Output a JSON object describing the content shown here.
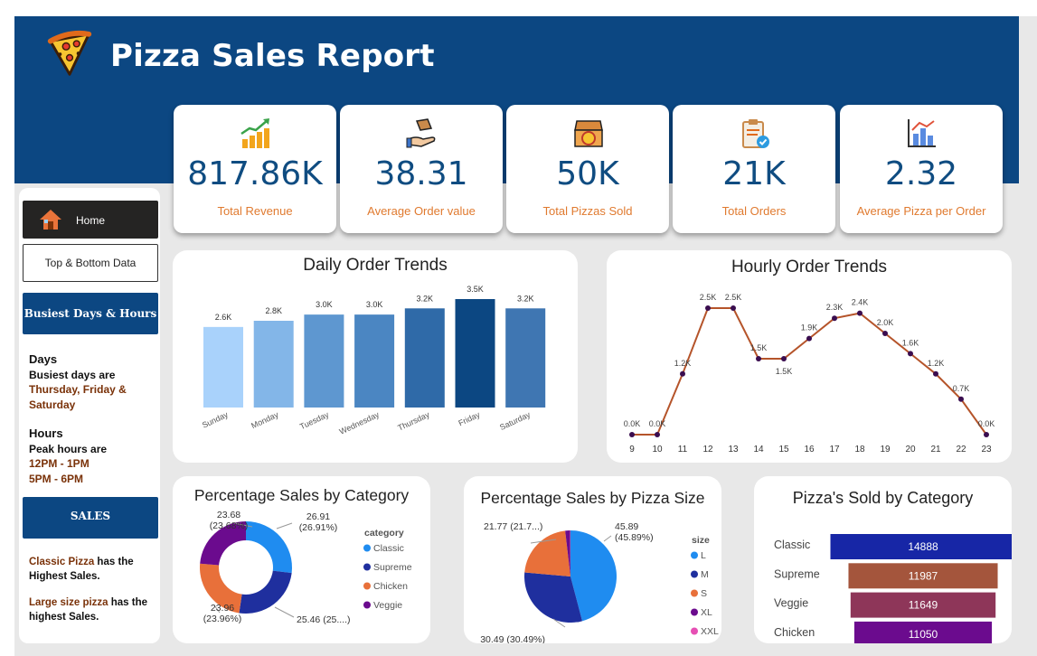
{
  "header": {
    "title": "Pizza Sales Report",
    "colors": {
      "banner": "#0c4782",
      "kpi_value": "#0f4c81",
      "kpi_label": "#e07a2f"
    }
  },
  "kpis": [
    {
      "icon": "rising-coins-chart-icon",
      "value": "817.86K",
      "label": "Total Revenue"
    },
    {
      "icon": "hand-with-box-icon",
      "value": "38.31",
      "label": "Average Order value"
    },
    {
      "icon": "pizza-box-icon",
      "value": "50K",
      "label": "Total Pizzas Sold"
    },
    {
      "icon": "clipboard-check-icon",
      "value": "21K",
      "label": "Total Orders"
    },
    {
      "icon": "bar-chart-icon",
      "value": "2.32",
      "label": "Average Pizza per Order"
    }
  ],
  "sidebar": {
    "home_label": "Home",
    "top_bottom_label": "Top & Bottom Data",
    "busiest_label": "Busiest Days & Hours",
    "days_heading": "Days",
    "days_text": "Busiest days are",
    "days_value_1": "Thursday, Friday &",
    "days_value_2": "Saturday",
    "hours_heading": "Hours",
    "hours_text": "Peak hours are",
    "hours_value_1": "12PM - 1PM",
    "hours_value_2": "5PM - 6PM",
    "sales_label": "SALES",
    "sales_line1_hl": "Classic Pizza",
    "sales_line1_rest": " has the",
    "sales_line1_end": "Highest Sales.",
    "sales_line2_hl": "Large size pizza",
    "sales_line2_rest": " has the",
    "sales_line2_end": "highest Sales."
  },
  "charts": {
    "daily_title": "Daily Order Trends",
    "hourly_title": "Hourly Order Trends",
    "category_title": "Percentage Sales by Category",
    "size_title": "Percentage Sales by Pizza Size",
    "sold_title": "Pizza's Sold by Category"
  },
  "chart_data": [
    {
      "id": "daily",
      "type": "bar",
      "title": "Daily Order Trends",
      "categories": [
        "Sunday",
        "Monday",
        "Tuesday",
        "Wednesday",
        "Thursday",
        "Friday",
        "Saturday"
      ],
      "values": [
        2.6,
        2.8,
        3.0,
        3.0,
        3.2,
        3.5,
        3.2
      ],
      "labels": [
        "2.6K",
        "2.8K",
        "3.0K",
        "3.0K",
        "3.2K",
        "3.5K",
        "3.2K"
      ],
      "colors": [
        "#a9d2fb",
        "#83b6e8",
        "#5e97d0",
        "#4b86c2",
        "#2f6aa8",
        "#0c4782",
        "#3f76b2"
      ],
      "ylim": [
        0,
        3.5
      ]
    },
    {
      "id": "hourly",
      "type": "line",
      "title": "Hourly Order Trends",
      "x": [
        9,
        10,
        11,
        12,
        13,
        14,
        15,
        16,
        17,
        18,
        19,
        20,
        21,
        22,
        23
      ],
      "values": [
        0.0,
        0.0,
        1.2,
        2.5,
        2.5,
        1.5,
        1.5,
        1.9,
        2.3,
        2.4,
        2.0,
        1.6,
        1.2,
        0.7,
        0.0
      ],
      "labels": [
        "0.0K",
        "0.0K",
        "1.2K",
        "2.5K",
        "2.5K",
        "1.5K",
        "1.5K",
        "1.9K",
        "2.3K",
        "2.4K",
        "2.0K",
        "1.6K",
        "1.2K",
        "0.7K",
        "0.0K"
      ],
      "line_color": "#b5542a",
      "marker_color": "#3a0d4f"
    },
    {
      "id": "category",
      "type": "pie",
      "title": "Percentage Sales by Category",
      "legend_title": "category",
      "legend_position": "right",
      "series": [
        {
          "name": "Classic",
          "value": 26.91,
          "label": "26.91",
          "pct": "(26.91%)",
          "color": "#1f8cf0"
        },
        {
          "name": "Supreme",
          "value": 25.46,
          "label": "25.46 (25....)",
          "pct": "",
          "color": "#1f2f9e"
        },
        {
          "name": "Chicken",
          "value": 23.96,
          "label": "23.96",
          "pct": "(23.96%)",
          "color": "#e8703a"
        },
        {
          "name": "Veggie",
          "value": 23.68,
          "label": "23.68",
          "pct": "(23.68%)",
          "color": "#6b0b8e"
        }
      ]
    },
    {
      "id": "size",
      "type": "pie",
      "title": "Percentage Sales by Pizza Size",
      "legend_title": "size",
      "legend_position": "right",
      "series": [
        {
          "name": "L",
          "value": 45.89,
          "label": "45.89",
          "pct": "(45.89%)",
          "color": "#1f8cf0"
        },
        {
          "name": "M",
          "value": 30.49,
          "label": "30.49 (30.49%)",
          "pct": "",
          "color": "#1f2f9e"
        },
        {
          "name": "S",
          "value": 21.77,
          "label": "21.77 (21.7...)",
          "pct": "",
          "color": "#e8703a"
        },
        {
          "name": "XL",
          "value": 1.72,
          "label": "",
          "pct": "",
          "color": "#6b0b8e"
        },
        {
          "name": "XXL",
          "value": 0.12,
          "label": "",
          "pct": "",
          "color": "#e64fb4"
        }
      ]
    },
    {
      "id": "sold",
      "type": "bar",
      "title": "Pizza's Sold by Category",
      "orientation": "horizontal",
      "categories": [
        "Classic",
        "Supreme",
        "Veggie",
        "Chicken"
      ],
      "values": [
        14888,
        11987,
        11649,
        11050
      ],
      "colors": [
        "#1726a6",
        "#a4553c",
        "#8e3659",
        "#6b0b8e"
      ]
    }
  ]
}
